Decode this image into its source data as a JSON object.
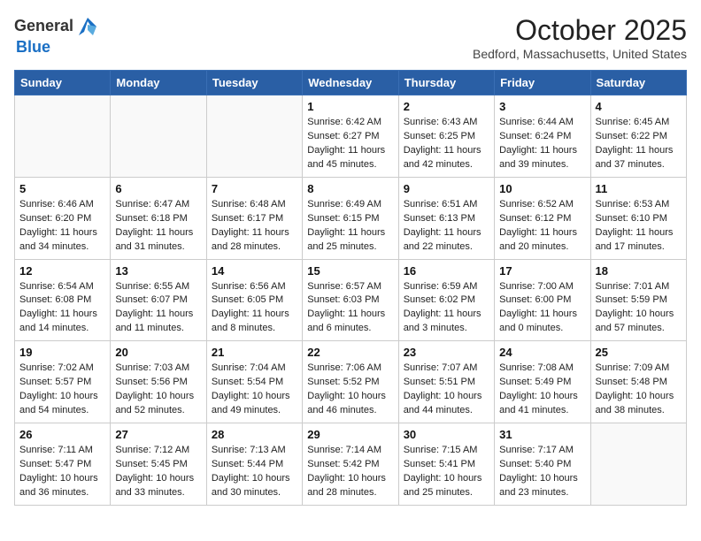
{
  "header": {
    "logo_general": "General",
    "logo_blue": "Blue",
    "month": "October 2025",
    "location": "Bedford, Massachusetts, United States"
  },
  "days_of_week": [
    "Sunday",
    "Monday",
    "Tuesday",
    "Wednesday",
    "Thursday",
    "Friday",
    "Saturday"
  ],
  "weeks": [
    [
      {
        "day": "",
        "info": ""
      },
      {
        "day": "",
        "info": ""
      },
      {
        "day": "",
        "info": ""
      },
      {
        "day": "1",
        "info": "Sunrise: 6:42 AM\nSunset: 6:27 PM\nDaylight: 11 hours\nand 45 minutes."
      },
      {
        "day": "2",
        "info": "Sunrise: 6:43 AM\nSunset: 6:25 PM\nDaylight: 11 hours\nand 42 minutes."
      },
      {
        "day": "3",
        "info": "Sunrise: 6:44 AM\nSunset: 6:24 PM\nDaylight: 11 hours\nand 39 minutes."
      },
      {
        "day": "4",
        "info": "Sunrise: 6:45 AM\nSunset: 6:22 PM\nDaylight: 11 hours\nand 37 minutes."
      }
    ],
    [
      {
        "day": "5",
        "info": "Sunrise: 6:46 AM\nSunset: 6:20 PM\nDaylight: 11 hours\nand 34 minutes."
      },
      {
        "day": "6",
        "info": "Sunrise: 6:47 AM\nSunset: 6:18 PM\nDaylight: 11 hours\nand 31 minutes."
      },
      {
        "day": "7",
        "info": "Sunrise: 6:48 AM\nSunset: 6:17 PM\nDaylight: 11 hours\nand 28 minutes."
      },
      {
        "day": "8",
        "info": "Sunrise: 6:49 AM\nSunset: 6:15 PM\nDaylight: 11 hours\nand 25 minutes."
      },
      {
        "day": "9",
        "info": "Sunrise: 6:51 AM\nSunset: 6:13 PM\nDaylight: 11 hours\nand 22 minutes."
      },
      {
        "day": "10",
        "info": "Sunrise: 6:52 AM\nSunset: 6:12 PM\nDaylight: 11 hours\nand 20 minutes."
      },
      {
        "day": "11",
        "info": "Sunrise: 6:53 AM\nSunset: 6:10 PM\nDaylight: 11 hours\nand 17 minutes."
      }
    ],
    [
      {
        "day": "12",
        "info": "Sunrise: 6:54 AM\nSunset: 6:08 PM\nDaylight: 11 hours\nand 14 minutes."
      },
      {
        "day": "13",
        "info": "Sunrise: 6:55 AM\nSunset: 6:07 PM\nDaylight: 11 hours\nand 11 minutes."
      },
      {
        "day": "14",
        "info": "Sunrise: 6:56 AM\nSunset: 6:05 PM\nDaylight: 11 hours\nand 8 minutes."
      },
      {
        "day": "15",
        "info": "Sunrise: 6:57 AM\nSunset: 6:03 PM\nDaylight: 11 hours\nand 6 minutes."
      },
      {
        "day": "16",
        "info": "Sunrise: 6:59 AM\nSunset: 6:02 PM\nDaylight: 11 hours\nand 3 minutes."
      },
      {
        "day": "17",
        "info": "Sunrise: 7:00 AM\nSunset: 6:00 PM\nDaylight: 11 hours\nand 0 minutes."
      },
      {
        "day": "18",
        "info": "Sunrise: 7:01 AM\nSunset: 5:59 PM\nDaylight: 10 hours\nand 57 minutes."
      }
    ],
    [
      {
        "day": "19",
        "info": "Sunrise: 7:02 AM\nSunset: 5:57 PM\nDaylight: 10 hours\nand 54 minutes."
      },
      {
        "day": "20",
        "info": "Sunrise: 7:03 AM\nSunset: 5:56 PM\nDaylight: 10 hours\nand 52 minutes."
      },
      {
        "day": "21",
        "info": "Sunrise: 7:04 AM\nSunset: 5:54 PM\nDaylight: 10 hours\nand 49 minutes."
      },
      {
        "day": "22",
        "info": "Sunrise: 7:06 AM\nSunset: 5:52 PM\nDaylight: 10 hours\nand 46 minutes."
      },
      {
        "day": "23",
        "info": "Sunrise: 7:07 AM\nSunset: 5:51 PM\nDaylight: 10 hours\nand 44 minutes."
      },
      {
        "day": "24",
        "info": "Sunrise: 7:08 AM\nSunset: 5:49 PM\nDaylight: 10 hours\nand 41 minutes."
      },
      {
        "day": "25",
        "info": "Sunrise: 7:09 AM\nSunset: 5:48 PM\nDaylight: 10 hours\nand 38 minutes."
      }
    ],
    [
      {
        "day": "26",
        "info": "Sunrise: 7:11 AM\nSunset: 5:47 PM\nDaylight: 10 hours\nand 36 minutes."
      },
      {
        "day": "27",
        "info": "Sunrise: 7:12 AM\nSunset: 5:45 PM\nDaylight: 10 hours\nand 33 minutes."
      },
      {
        "day": "28",
        "info": "Sunrise: 7:13 AM\nSunset: 5:44 PM\nDaylight: 10 hours\nand 30 minutes."
      },
      {
        "day": "29",
        "info": "Sunrise: 7:14 AM\nSunset: 5:42 PM\nDaylight: 10 hours\nand 28 minutes."
      },
      {
        "day": "30",
        "info": "Sunrise: 7:15 AM\nSunset: 5:41 PM\nDaylight: 10 hours\nand 25 minutes."
      },
      {
        "day": "31",
        "info": "Sunrise: 7:17 AM\nSunset: 5:40 PM\nDaylight: 10 hours\nand 23 minutes."
      },
      {
        "day": "",
        "info": ""
      }
    ]
  ]
}
